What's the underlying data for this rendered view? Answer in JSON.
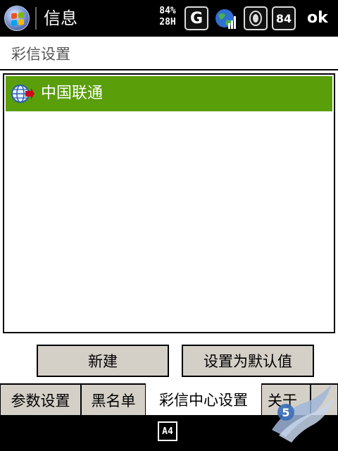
{
  "titlebar": {
    "app_title": "信息",
    "battery_percent": "84%",
    "battery_mode": "28H",
    "network_type": "G",
    "notification_count": "84",
    "ok_label": "ok",
    "icons": [
      "windows-start-icon",
      "globe-signal-icon",
      "speaker-icon"
    ]
  },
  "page": {
    "title": "彩信设置"
  },
  "list": {
    "items": [
      {
        "label": "中国联通",
        "icon": "network-globe-icon",
        "selected": true
      }
    ]
  },
  "buttons": {
    "new_label": "新建",
    "default_label": "设置为默认值"
  },
  "tabs": [
    {
      "label": "参数设置",
      "active": false
    },
    {
      "label": "黑名单",
      "active": false
    },
    {
      "label": "彩信中心设置",
      "active": true
    },
    {
      "label": "关于",
      "active": false
    }
  ],
  "bottombar": {
    "sip_label": "A4"
  },
  "colors": {
    "selection": "#5a9e0a",
    "tab_inactive": "#d4d0c8",
    "button_face": "#d4d0c8"
  }
}
